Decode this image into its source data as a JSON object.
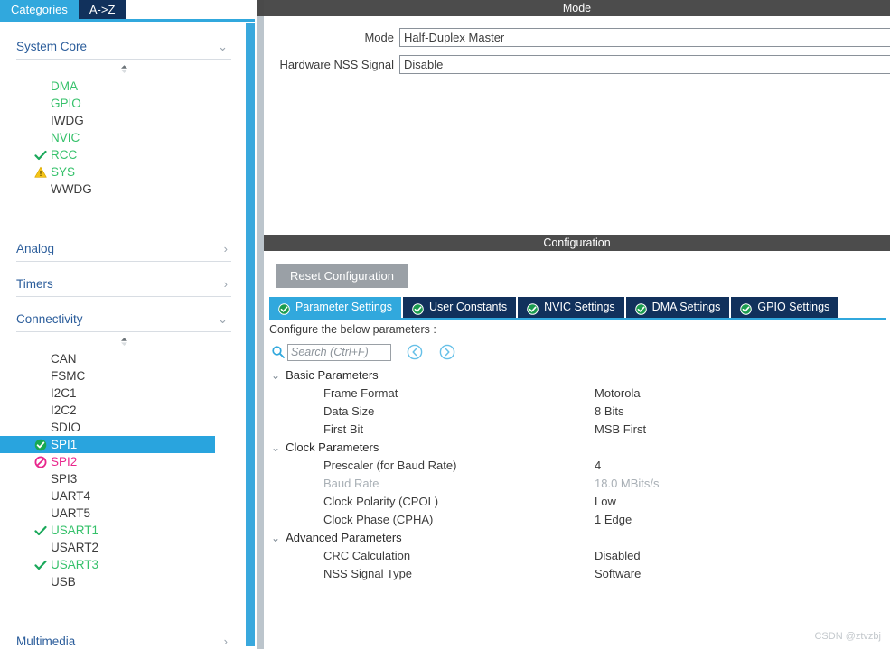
{
  "sidebar": {
    "tabs": [
      {
        "label": "Categories",
        "active": true
      },
      {
        "label": "A->Z",
        "active": false
      }
    ],
    "sections": [
      {
        "title": "System Core",
        "expanded": true,
        "items": [
          {
            "label": "DMA",
            "state": "configured",
            "icon": "none"
          },
          {
            "label": "GPIO",
            "state": "configured",
            "icon": "none"
          },
          {
            "label": "IWDG",
            "state": "default",
            "icon": "none"
          },
          {
            "label": "NVIC",
            "state": "configured",
            "icon": "none"
          },
          {
            "label": "RCC",
            "state": "configured",
            "icon": "check-icon"
          },
          {
            "label": "SYS",
            "state": "configured",
            "icon": "warning-icon"
          },
          {
            "label": "WWDG",
            "state": "default",
            "icon": "none"
          }
        ]
      },
      {
        "title": "Analog",
        "expanded": false,
        "items": []
      },
      {
        "title": "Timers",
        "expanded": false,
        "items": []
      },
      {
        "title": "Connectivity",
        "expanded": true,
        "items": [
          {
            "label": "CAN",
            "state": "default",
            "icon": "none"
          },
          {
            "label": "FSMC",
            "state": "default",
            "icon": "none"
          },
          {
            "label": "I2C1",
            "state": "default",
            "icon": "none"
          },
          {
            "label": "I2C2",
            "state": "default",
            "icon": "none"
          },
          {
            "label": "SDIO",
            "state": "default",
            "icon": "none"
          },
          {
            "label": "SPI1",
            "state": "selected",
            "icon": "check-circle-icon"
          },
          {
            "label": "SPI2",
            "state": "conflict",
            "icon": "forbidden-icon"
          },
          {
            "label": "SPI3",
            "state": "default",
            "icon": "none"
          },
          {
            "label": "UART4",
            "state": "default",
            "icon": "none"
          },
          {
            "label": "UART5",
            "state": "default",
            "icon": "none"
          },
          {
            "label": "USART1",
            "state": "configured",
            "icon": "check-icon"
          },
          {
            "label": "USART2",
            "state": "default",
            "icon": "none"
          },
          {
            "label": "USART3",
            "state": "configured",
            "icon": "check-icon"
          },
          {
            "label": "USB",
            "state": "default",
            "icon": "none"
          }
        ]
      },
      {
        "title": "Multimedia",
        "expanded": false,
        "items": []
      }
    ]
  },
  "mode_panel": {
    "title": "Mode",
    "fields": [
      {
        "label": "Mode",
        "value": "Half-Duplex Master"
      },
      {
        "label": "Hardware NSS Signal",
        "value": "Disable"
      }
    ]
  },
  "configuration_panel": {
    "title": "Configuration",
    "reset_label": "Reset Configuration",
    "tabs": [
      {
        "label": "Parameter Settings",
        "active": true,
        "icon": "check-circle-icon"
      },
      {
        "label": "User Constants",
        "active": false,
        "icon": "check-circle-icon"
      },
      {
        "label": "NVIC Settings",
        "active": false,
        "icon": "check-circle-icon"
      },
      {
        "label": "DMA Settings",
        "active": false,
        "icon": "check-circle-icon"
      },
      {
        "label": "GPIO Settings",
        "active": false,
        "icon": "check-circle-icon"
      }
    ],
    "note": "Configure the below parameters :",
    "search": {
      "placeholder": "Search (Ctrl+F)",
      "value": ""
    },
    "nav": {
      "prev": "previous-match",
      "next": "next-match"
    },
    "groups": [
      {
        "name": "Basic Parameters",
        "expanded": true,
        "rows": [
          {
            "name": "Frame Format",
            "value": "Motorola",
            "disabled": false
          },
          {
            "name": "Data Size",
            "value": "8 Bits",
            "disabled": false
          },
          {
            "name": "First Bit",
            "value": "MSB First",
            "disabled": false
          }
        ]
      },
      {
        "name": "Clock Parameters",
        "expanded": true,
        "rows": [
          {
            "name": "Prescaler (for Baud Rate)",
            "value": "4",
            "disabled": false
          },
          {
            "name": "Baud Rate",
            "value": "18.0 MBits/s",
            "disabled": true
          },
          {
            "name": "Clock Polarity (CPOL)",
            "value": "Low",
            "disabled": false
          },
          {
            "name": "Clock Phase (CPHA)",
            "value": "1 Edge",
            "disabled": false
          }
        ]
      },
      {
        "name": "Advanced Parameters",
        "expanded": true,
        "rows": [
          {
            "name": "CRC Calculation",
            "value": "Disabled",
            "disabled": false
          },
          {
            "name": "NSS Signal Type",
            "value": "Software",
            "disabled": false
          }
        ]
      }
    ]
  },
  "watermark": "CSDN @ztvzbj",
  "colors": {
    "accent_blue": "#31a8dd",
    "tab_navy": "#11315c",
    "title_bar": "#4c4c4c",
    "green": "#35c16a",
    "pink": "#e8268c",
    "warning_yellow": "#f5c518",
    "section_title": "#2b5d9b",
    "selected_row": "#29a4de",
    "disabled_text": "#a9b0b6"
  }
}
